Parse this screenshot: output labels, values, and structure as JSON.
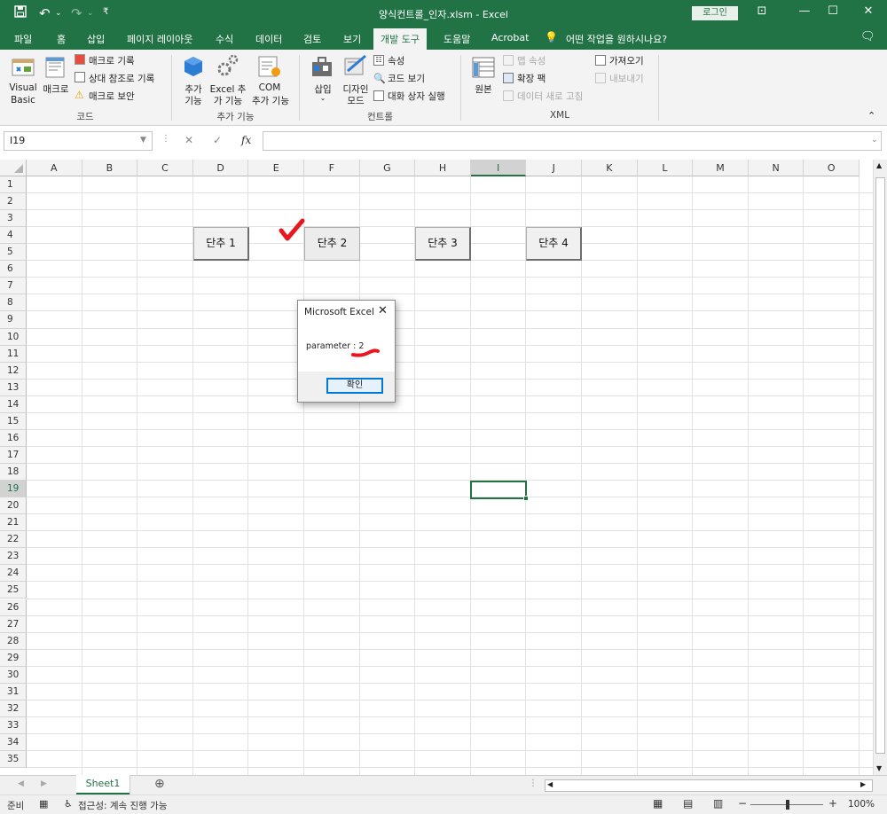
{
  "window": {
    "title": "양식컨트롤_인자.xlsm  -  Excel",
    "login_label": "로그인"
  },
  "tabs": [
    "파일",
    "홈",
    "삽입",
    "페이지 레이아웃",
    "수식",
    "데이터",
    "검토",
    "보기",
    "개발 도구",
    "도움말",
    "Acrobat"
  ],
  "active_tab": "개발 도구",
  "tellme": "어떤 작업을 원하시나요?",
  "ribbon": {
    "code": {
      "visual_basic": [
        "Visual",
        "Basic"
      ],
      "macros": "매크로",
      "record": "매크로 기록",
      "relative": "상대 참조로 기록",
      "security": "매크로 보안",
      "group": "코드"
    },
    "addins": {
      "addins": [
        "추가",
        "기능"
      ],
      "excel_addins": [
        "Excel 추",
        "가 기능"
      ],
      "com_addins": [
        "COM",
        "추가 기능"
      ],
      "group": "추가 기능"
    },
    "controls": {
      "insert": "삽입",
      "design_mode": [
        "디자인",
        "모드"
      ],
      "properties": "속성",
      "view_code": "코드 보기",
      "run_dialog": "대화 상자 실행",
      "group": "컨트롤"
    },
    "xml": {
      "source": "원본",
      "map_properties": "맵 속성",
      "expansion_packs": "확장 팩",
      "refresh_data": "데이터 새로 고침",
      "import": "가져오기",
      "export": "내보내기",
      "group": "XML"
    }
  },
  "formula_bar": {
    "name_box": "I19",
    "fx": "fx",
    "value": ""
  },
  "grid": {
    "columns": [
      "A",
      "B",
      "C",
      "D",
      "E",
      "F",
      "G",
      "H",
      "I",
      "J",
      "K",
      "L",
      "M",
      "N",
      "O"
    ],
    "rows": [
      "1",
      "2",
      "3",
      "4",
      "5",
      "6",
      "7",
      "8",
      "9",
      "10",
      "11",
      "12",
      "13",
      "14",
      "15",
      "16",
      "17",
      "18",
      "19",
      "20",
      "21",
      "22",
      "23",
      "24",
      "25",
      "26",
      "27",
      "28",
      "29",
      "30",
      "31",
      "32",
      "33",
      "34",
      "35"
    ],
    "selected_column": "I",
    "selected_row": "19"
  },
  "buttons": [
    "단추 1",
    "단추 2",
    "단추 3",
    "단추 4"
  ],
  "dialog": {
    "title": "Microsoft Excel",
    "message_label": "parameter :",
    "message_value": "2",
    "ok": "확인"
  },
  "sheet": {
    "name": "Sheet1"
  },
  "status": {
    "ready": "준비",
    "accessibility": "접근성: 계속 진행 가능",
    "zoom": "100%"
  },
  "colors": {
    "accent": "#217346",
    "annotation": "#e8171f"
  }
}
